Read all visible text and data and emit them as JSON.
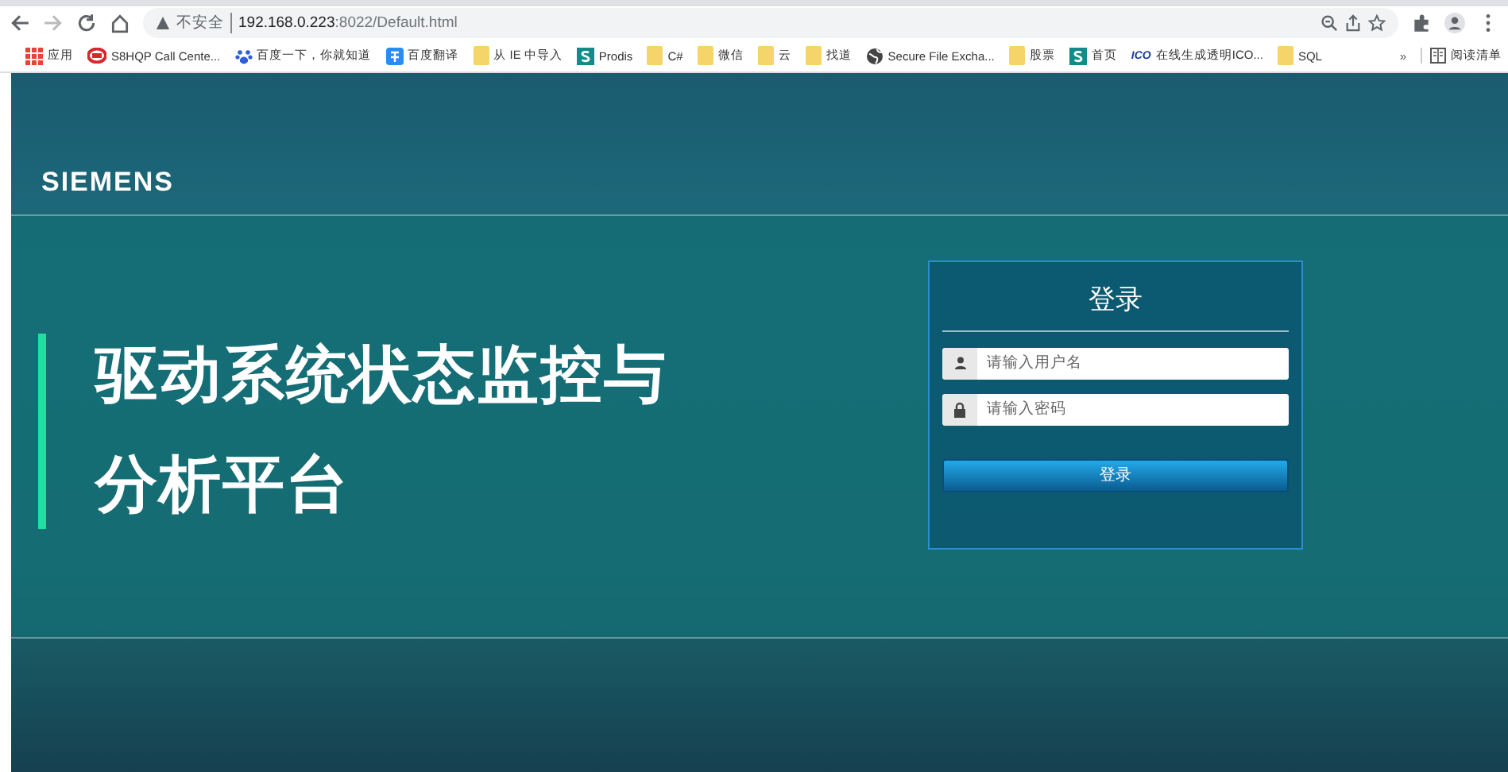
{
  "browser": {
    "security_label": "不安全",
    "url_host": "192.168.0.223",
    "url_path": ":8022/Default.html"
  },
  "bookmarks": [
    {
      "kind": "apps",
      "label": "应用"
    },
    {
      "kind": "red-logo",
      "label": "S8HQP Call Cente..."
    },
    {
      "kind": "paw",
      "label": "百度一下，你就知道"
    },
    {
      "kind": "translate",
      "label": "百度翻译"
    },
    {
      "kind": "folder",
      "label": "从 IE 中导入"
    },
    {
      "kind": "s-logo",
      "label": "Prodis"
    },
    {
      "kind": "folder",
      "label": "C#"
    },
    {
      "kind": "folder",
      "label": "微信"
    },
    {
      "kind": "folder",
      "label": "云"
    },
    {
      "kind": "folder",
      "label": "找道"
    },
    {
      "kind": "globe",
      "label": "Secure File Excha..."
    },
    {
      "kind": "folder",
      "label": "股票"
    },
    {
      "kind": "s-logo",
      "label": "首页"
    },
    {
      "kind": "ico",
      "label": "在线生成透明ICO...",
      "badge": "ICO"
    },
    {
      "kind": "folder",
      "label": "SQL"
    }
  ],
  "bookmarks_more": "»",
  "reading_list": "阅读清单",
  "page": {
    "logo": "SIEMENS",
    "title_lines": [
      "驱动系统状态监控与",
      "分析平台"
    ],
    "login": {
      "heading": "登录",
      "username": {
        "placeholder": "请输入用户名"
      },
      "password": {
        "placeholder": "请输入密码"
      },
      "button": "登录"
    }
  }
}
